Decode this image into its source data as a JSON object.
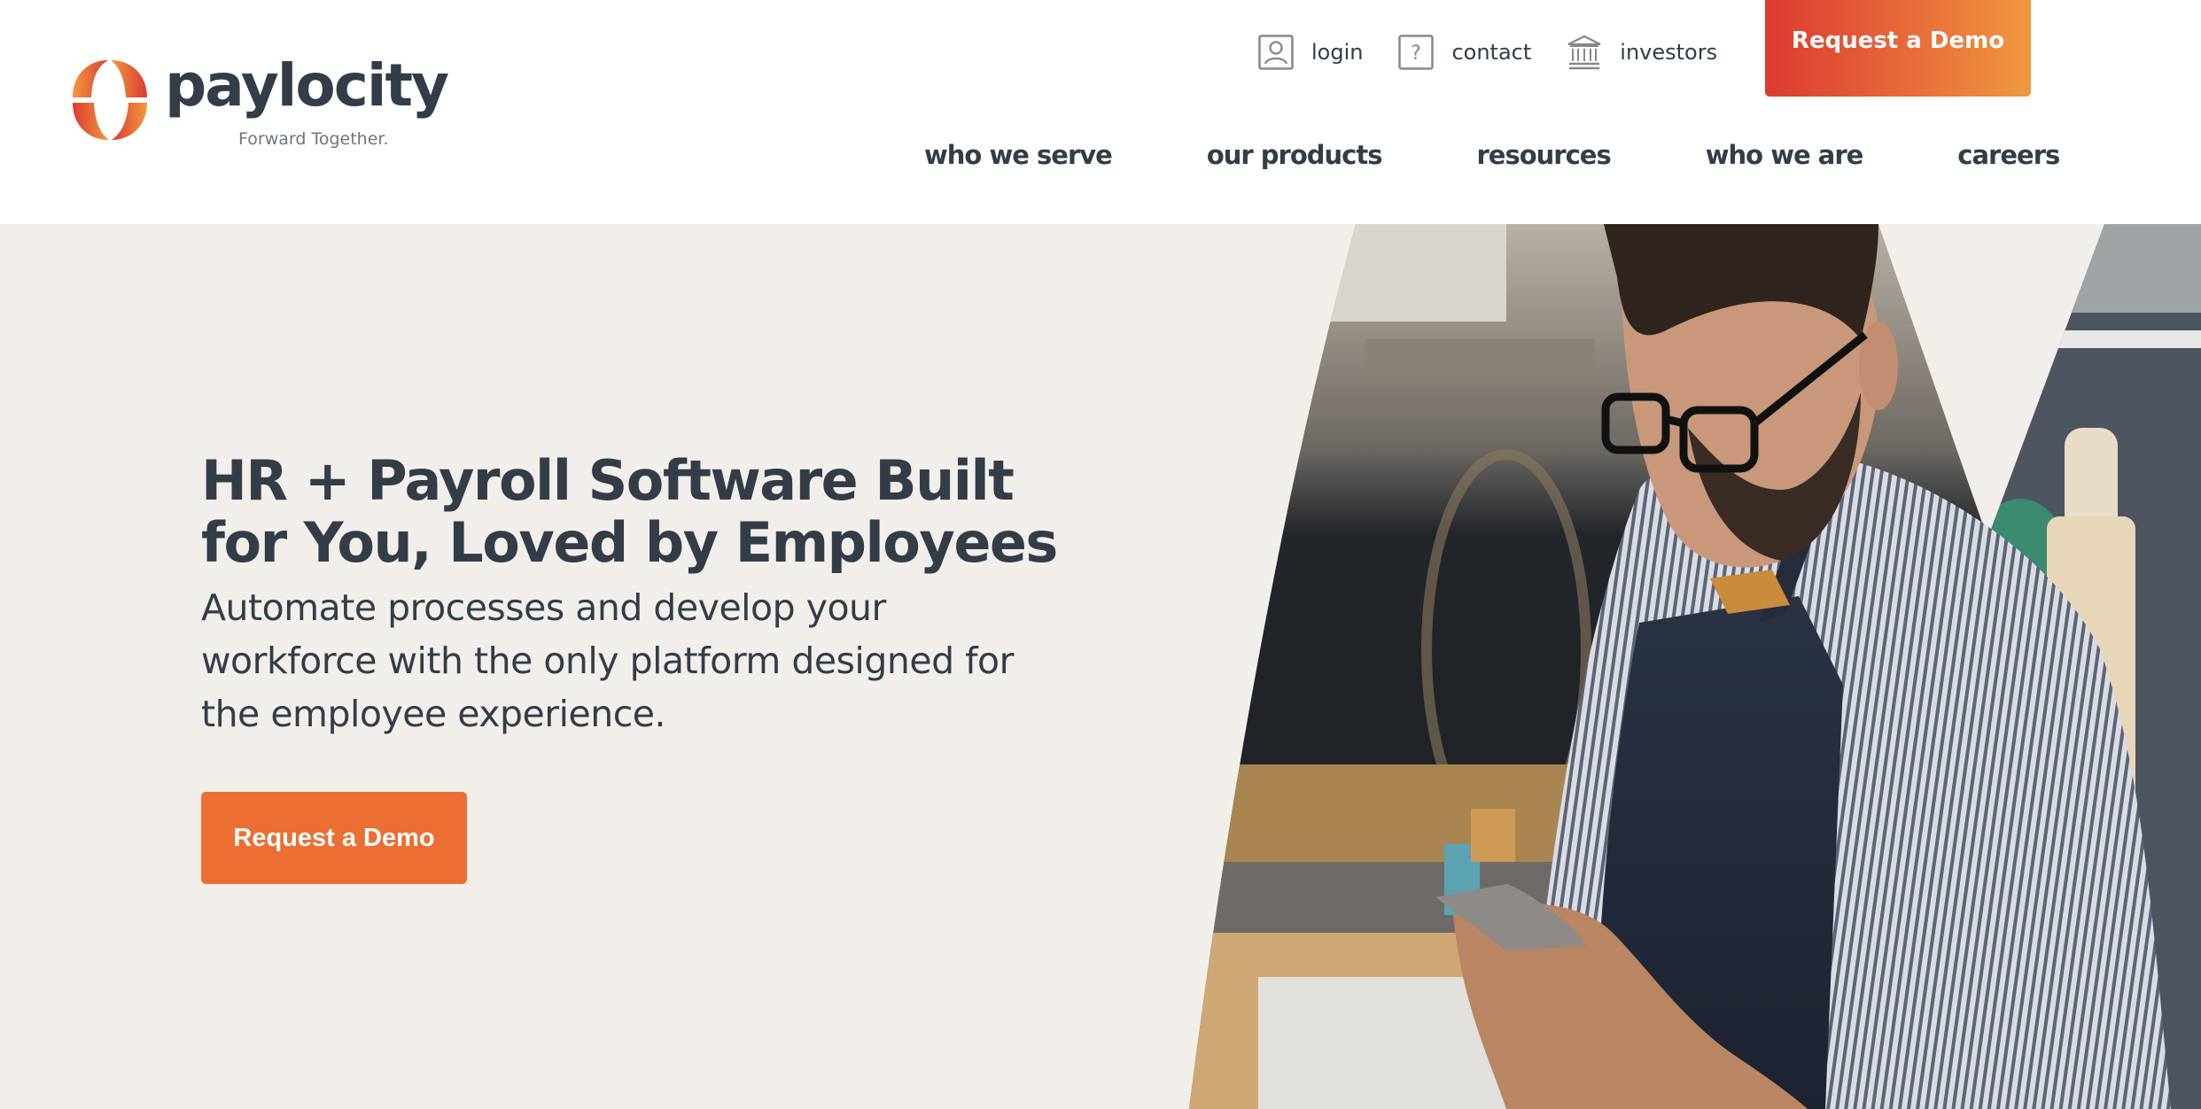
{
  "brand": {
    "name": "paylocity",
    "tagline": "Forward Together.",
    "colors": {
      "text_dark": "#323d48",
      "accent_orange": "#eb6e33",
      "gradient_start": "#dc3a31",
      "gradient_end": "#f0983f",
      "hero_background": "#f2efea"
    }
  },
  "utility_nav": [
    {
      "label": "login",
      "icon": "user-icon"
    },
    {
      "label": "contact",
      "icon": "question-icon"
    },
    {
      "label": "investors",
      "icon": "bank-building-icon"
    }
  ],
  "header_cta": {
    "label": "Request a Demo"
  },
  "main_nav": [
    {
      "label": "who we serve"
    },
    {
      "label": "our products"
    },
    {
      "label": "resources"
    },
    {
      "label": "who we are"
    },
    {
      "label": "careers"
    }
  ],
  "hero": {
    "title": "HR + Payroll Software Built for You, Loved by Employees",
    "subtitle": "Automate processes and develop your workforce with the only platform designed for the employee experience.",
    "cta_label": "Request a Demo",
    "image": "photo-of-man-in-apron-using-smartphone-in-kitchen"
  }
}
